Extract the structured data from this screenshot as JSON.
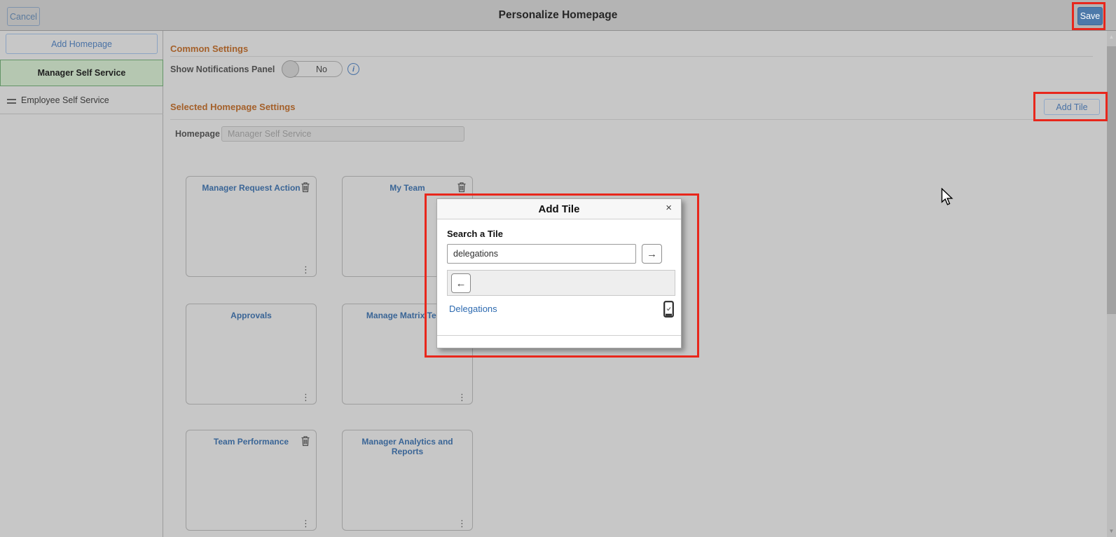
{
  "header": {
    "title": "Personalize Homepage",
    "cancel_label": "Cancel",
    "save_label": "Save"
  },
  "sidebar": {
    "add_homepage_label": "Add Homepage",
    "items": [
      {
        "label": "Manager Self Service",
        "selected": true
      },
      {
        "label": "Employee Self Service",
        "selected": false
      }
    ]
  },
  "common_settings": {
    "heading": "Common Settings",
    "notifications_label": "Show Notifications Panel",
    "toggle_value": "No"
  },
  "homepage_settings": {
    "heading": "Selected Homepage Settings",
    "add_tile_label": "Add Tile",
    "homepage_label": "Homepage",
    "homepage_value": "Manager Self Service"
  },
  "tiles": [
    {
      "title": "Manager Request Action",
      "removable": true
    },
    {
      "title": "My Team",
      "removable": true
    },
    {
      "title": "Approvals",
      "removable": false
    },
    {
      "title": "Manage Matrix Team",
      "removable": true
    },
    {
      "title": "Team Performance",
      "removable": true
    },
    {
      "title": "Manager Analytics and Reports",
      "removable": false
    }
  ],
  "modal": {
    "title": "Add Tile",
    "search_label": "Search a Tile",
    "search_value": "delegations",
    "results": [
      {
        "label": "Delegations"
      }
    ]
  },
  "icons": {
    "close": "×",
    "arrow_right": "→",
    "arrow_left": "←",
    "ellipsis": "⋮",
    "scroll_up": "▲",
    "scroll_down": "▼",
    "info": "i"
  },
  "colors": {
    "accent_blue": "#4d79a9",
    "link_blue": "#2d6ab0",
    "heading_orange": "#a4602a",
    "highlight_red": "#e8271c",
    "selected_green_bg": "#b5c7b1",
    "selected_green_border": "#649468"
  }
}
